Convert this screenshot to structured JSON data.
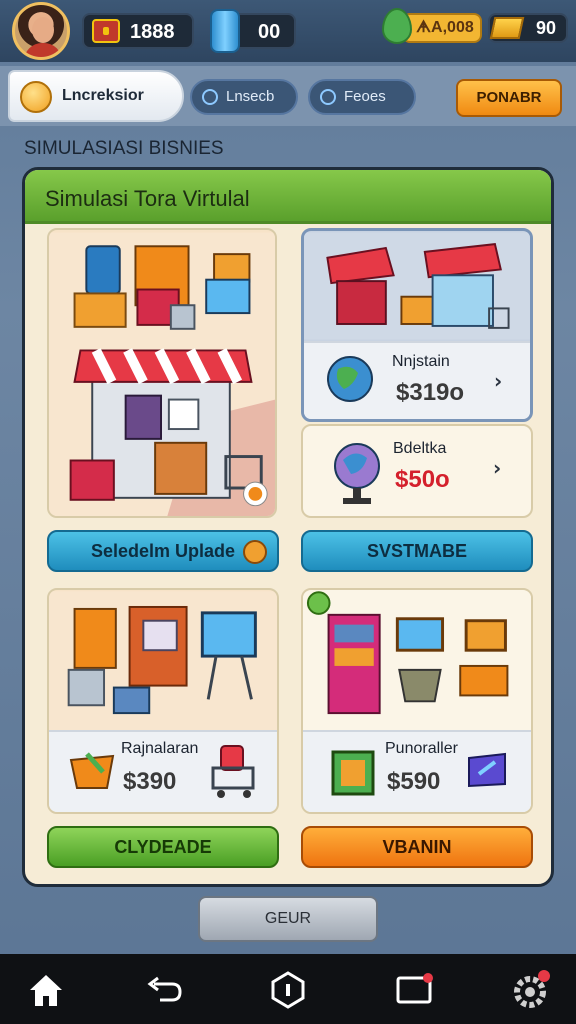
{
  "top_bar": {
    "gems": "1888",
    "energy": "00",
    "cash": "ᗗA,008",
    "gold": "90"
  },
  "nav": {
    "main_tab": "Lncreksior",
    "tab_2": "Lnsecb",
    "tab_3": "Feoes",
    "action_button": "PONABR"
  },
  "section_title": "SIMULASIASI BISNIES",
  "panel": {
    "title": "Simulasi Tora Virtulal",
    "items": [
      {
        "name": "Nnjstain",
        "price": "$319o"
      },
      {
        "name": "Bdeltka",
        "price": "$50o"
      },
      {
        "name": "Rajnalaran",
        "price": "$390"
      },
      {
        "name": "Punoraller",
        "price": "$590"
      }
    ],
    "upgrade_button": "Seledelm Uplade",
    "system_button": "SVSTMABE",
    "green_button": "CLYDEADE",
    "orange_button": "VBANIN"
  },
  "back_button": "GEUR",
  "colors": {
    "header_green": "#5aa02c",
    "teal": "#1f8dbd",
    "green": "#4a9f24",
    "orange": "#ef7410",
    "price_red": "#d4202c"
  },
  "icons": [
    "home-icon",
    "back-icon",
    "hexagon-icon",
    "recent-apps-icon",
    "settings-icon"
  ]
}
